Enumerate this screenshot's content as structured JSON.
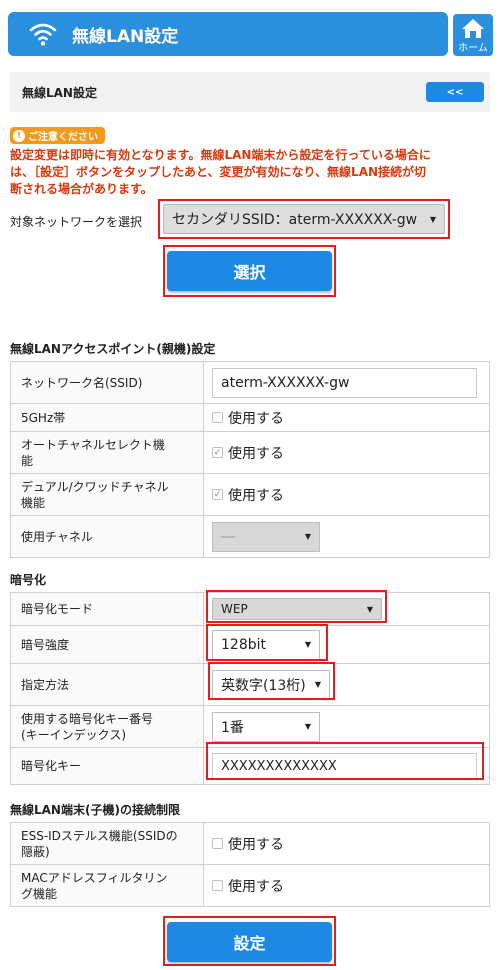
{
  "header": {
    "title": "無線LAN設定",
    "home_label": "ホーム"
  },
  "section": {
    "label": "無線LAN設定",
    "back_label": "<<"
  },
  "caution": {
    "badge": "ご注意ください",
    "line1": "設定変更は即時に有効となります。無線LAN端末から設定を行っている場合に",
    "line2": "は、［設定］ボタンをタップしたあと、変更が有効になり、無線LAN接続が切",
    "line3": "断される場合があります。"
  },
  "target": {
    "label": "対象ネットワークを選択",
    "value": "セカンダリSSID：aterm-XXXXXX-gw"
  },
  "select_button": "選択",
  "ap_section": {
    "title": "無線LANアクセスポイント(親機)設定",
    "ssid_label": "ネットワーク名(SSID)",
    "ssid_value": "aterm-XXXXXX-gw",
    "band_label": "5GHz帯",
    "band_check": "使用する",
    "auto_label1": "オートチャネルセレクト機",
    "auto_label2": "能",
    "auto_check": "使用する",
    "dual_label1": "デュアル/クワッドチャネル",
    "dual_label2": "機能",
    "dual_check": "使用する",
    "channel_label": "使用チャネル",
    "channel_value": "―"
  },
  "enc_section": {
    "title": "暗号化",
    "mode_label": "暗号化モード",
    "mode_value": "WEP",
    "strength_label": "暗号強度",
    "strength_value": "128bit",
    "method_label": "指定方法",
    "method_value": "英数字(13桁)",
    "keyidx_label1": "使用する暗号化キー番号",
    "keyidx_label2": "(キーインデックス)",
    "keyidx_value": "1番",
    "key_label": "暗号化キー",
    "key_value": "XXXXXXXXXXXXX"
  },
  "limit_section": {
    "title": "無線LAN端末(子機)の接続制限",
    "stealth_label1": "ESS-IDステルス機能(SSIDの",
    "stealth_label2": "隠蔽)",
    "stealth_check": "使用する",
    "mac_label1": "MACアドレスフィルタリン",
    "mac_label2": "グ機能",
    "mac_check": "使用する"
  },
  "submit_button": "設定",
  "colors": {
    "accent": "#2a8fdc",
    "highlight": "#e02020",
    "warning": "#d83a10"
  },
  "icons": [
    "wifi-icon",
    "home-icon",
    "dropdown-arrow-icon",
    "checkbox-icon"
  ]
}
